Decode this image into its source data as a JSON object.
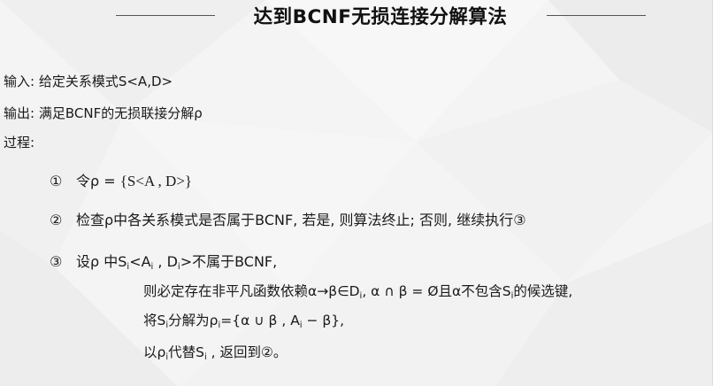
{
  "title": "达到BCNF无损连接分解算法",
  "input": {
    "label": "输入:",
    "text": "给定关系模式S<A,D>"
  },
  "output": {
    "label": "输出:",
    "text": "满足BCNF的无损联接分解ρ"
  },
  "process": {
    "label": "过程:"
  },
  "steps": [
    {
      "num": "①",
      "text_a": "令ρ = ",
      "formula": "{S<A , D>}"
    },
    {
      "num": "②",
      "text": "检查ρ中各关系模式是否属于BCNF, 若是, 则算法终止; 否则, 继续执行③"
    },
    {
      "num": "③",
      "intro": {
        "a": "设ρ 中S",
        "b": "<A",
        "c": " , D",
        "d": ">不属于BCNF,",
        "sub": "i"
      },
      "sub1": {
        "a": "则必定存在非平凡函数依赖α→β∈D",
        "b": ", α ∩ β = Ø且α不包含S",
        "c": "的候选键,",
        "sub": "i"
      },
      "sub2": {
        "a": "将S",
        "b": "分解为ρ",
        "c": "={α ∪ β , A",
        "d": " − β},",
        "sub": "i"
      },
      "sub3": {
        "a": "以ρ",
        "b": "代替S",
        "c": " , 返回到②。",
        "sub": "i"
      }
    }
  ],
  "colors": {
    "background": "#f3f3f3",
    "text": "#1a1a1a",
    "rule": "#555555"
  }
}
